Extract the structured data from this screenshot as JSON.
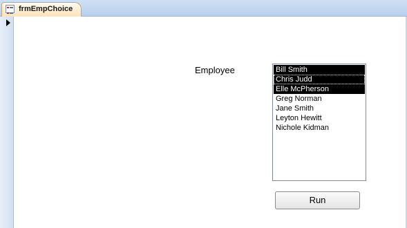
{
  "tab": {
    "title": "frmEmpChoice",
    "icon": "form-icon"
  },
  "form": {
    "employee_label": "Employee",
    "employees": [
      {
        "name": "Bill Smith",
        "selected": true,
        "focused": false
      },
      {
        "name": "Chris Judd",
        "selected": true,
        "focused": true
      },
      {
        "name": "Elle McPherson",
        "selected": true,
        "focused": false
      },
      {
        "name": "Greg Norman",
        "selected": false,
        "focused": false
      },
      {
        "name": "Jane Smith",
        "selected": false,
        "focused": false
      },
      {
        "name": "Leyton Hewitt",
        "selected": false,
        "focused": false
      },
      {
        "name": "Nichole Kidman",
        "selected": false,
        "focused": false
      }
    ],
    "run_label": "Run"
  },
  "colors": {
    "selection": "#000000",
    "tab_accent": "#fbe3b9",
    "bar": "#c6d8f0"
  }
}
